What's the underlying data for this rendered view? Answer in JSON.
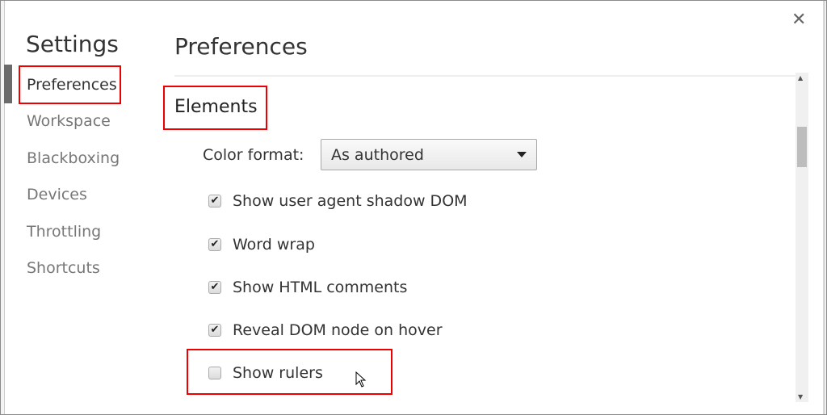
{
  "sidebar": {
    "title": "Settings",
    "items": [
      {
        "label": "Preferences",
        "active": true
      },
      {
        "label": "Workspace"
      },
      {
        "label": "Blackboxing"
      },
      {
        "label": "Devices"
      },
      {
        "label": "Throttling"
      },
      {
        "label": "Shortcuts"
      }
    ]
  },
  "main": {
    "title": "Preferences",
    "close_icon": "close-icon",
    "section": "Elements",
    "color_format": {
      "label": "Color format:",
      "value": "As authored"
    },
    "checkboxes": [
      {
        "label": "Show user agent shadow DOM",
        "checked": true
      },
      {
        "label": "Word wrap",
        "checked": true
      },
      {
        "label": "Show HTML comments",
        "checked": true
      },
      {
        "label": "Reveal DOM node on hover",
        "checked": true
      },
      {
        "label": "Show rulers",
        "checked": false
      }
    ]
  },
  "colors": {
    "highlight": "#ee0000"
  }
}
